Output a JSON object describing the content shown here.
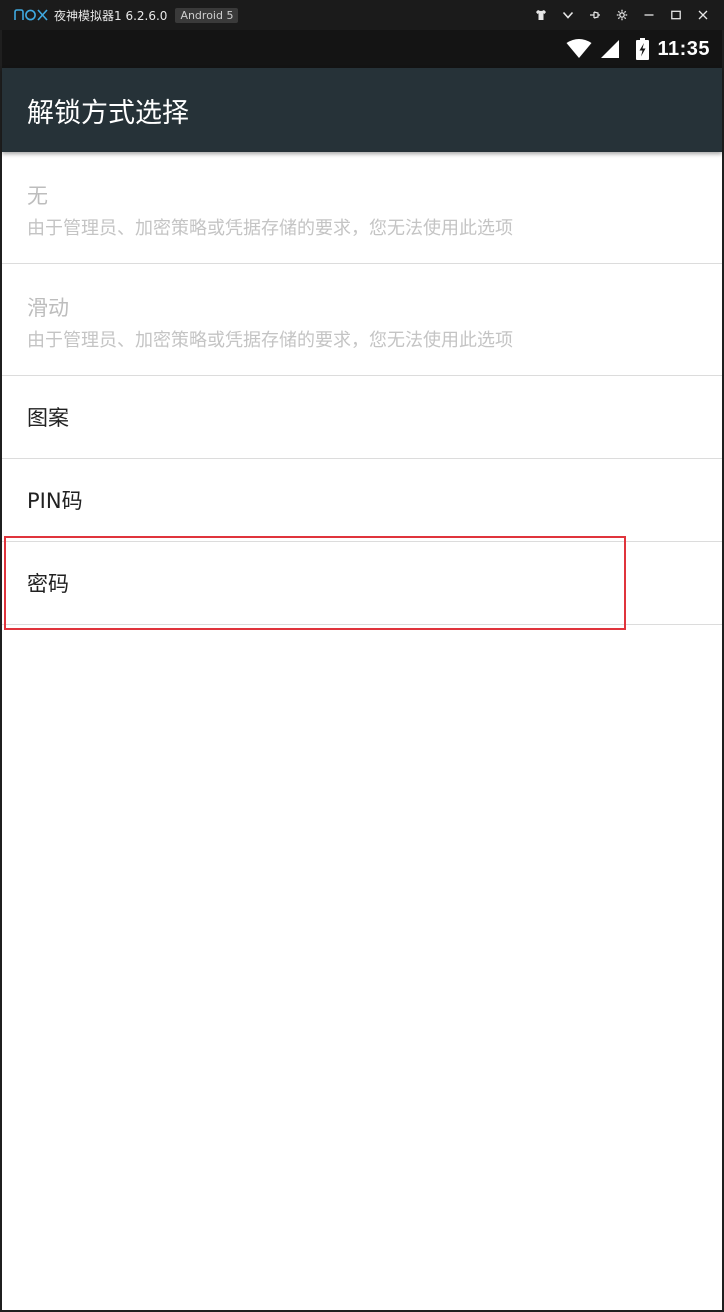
{
  "emulator": {
    "logo": "nox",
    "title": "夜神模拟器1 6.2.6.0",
    "badge": "Android 5",
    "controls": [
      "shirt-icon",
      "chevron-down-icon",
      "pin-icon",
      "gear-icon",
      "minimize-icon",
      "maximize-icon",
      "close-icon"
    ]
  },
  "status_bar": {
    "time": "11:35",
    "icons": [
      "wifi-icon",
      "signal-icon",
      "battery-charging-icon"
    ]
  },
  "app_bar": {
    "title": "解锁方式选择"
  },
  "options": [
    {
      "title": "无",
      "summary": "由于管理员、加密策略或凭据存储的要求，您无法使用此选项",
      "enabled": false
    },
    {
      "title": "滑动",
      "summary": "由于管理员、加密策略或凭据存储的要求，您无法使用此选项",
      "enabled": false
    },
    {
      "title": "图案",
      "enabled": true
    },
    {
      "title": "PIN码",
      "enabled": true
    },
    {
      "title": "密码",
      "enabled": true,
      "highlighted": true
    }
  ],
  "colors": {
    "app_bar": "#263238",
    "status_bar": "#141414",
    "highlight": "#e0343c",
    "nox_accent": "#3fa9e0"
  }
}
